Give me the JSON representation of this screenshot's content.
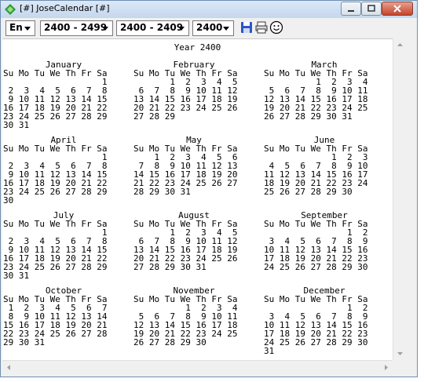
{
  "window": {
    "title": "[#] JoseCalendar [#]"
  },
  "toolbar": {
    "language": "En",
    "century": "2400 - 2499",
    "decade": "2400 - 2409",
    "year": "2400",
    "icons": [
      "save-icon",
      "print-icon",
      "smiley-icon"
    ]
  },
  "calendar": {
    "year_title": "Year 2400",
    "weekday_header": "Su Mo Tu We Th Fr Sa",
    "months": [
      {
        "name": "January",
        "weeks": [
          "                   1",
          " 2  3  4  5  6  7  8",
          " 9 10 11 12 13 14 15",
          "16 17 18 19 20 21 22",
          "23 24 25 26 27 28 29",
          "30 31"
        ]
      },
      {
        "name": "February",
        "weeks": [
          "       1  2  3  4  5",
          " 6  7  8  9 10 11 12",
          "13 14 15 16 17 18 19",
          "20 21 22 23 24 25 26",
          "27 28 29"
        ]
      },
      {
        "name": "March",
        "weeks": [
          "          1  2  3  4",
          " 5  6  7  8  9 10 11",
          "12 13 14 15 16 17 18",
          "19 20 21 22 23 24 25",
          "26 27 28 29 30 31"
        ]
      },
      {
        "name": "April",
        "weeks": [
          "                   1",
          " 2  3  4  5  6  7  8",
          " 9 10 11 12 13 14 15",
          "16 17 18 19 20 21 22",
          "23 24 25 26 27 28 29",
          "30"
        ]
      },
      {
        "name": "May",
        "weeks": [
          "    1  2  3  4  5  6",
          " 7  8  9 10 11 12 13",
          "14 15 16 17 18 19 20",
          "21 22 23 24 25 26 27",
          "28 29 30 31"
        ]
      },
      {
        "name": "June",
        "weeks": [
          "             1  2  3",
          " 4  5  6  7  8  9 10",
          "11 12 13 14 15 16 17",
          "18 19 20 21 22 23 24",
          "25 26 27 28 29 30"
        ]
      },
      {
        "name": "July",
        "weeks": [
          "                   1",
          " 2  3  4  5  6  7  8",
          " 9 10 11 12 13 14 15",
          "16 17 18 19 20 21 22",
          "23 24 25 26 27 28 29",
          "30 31"
        ]
      },
      {
        "name": "August",
        "weeks": [
          "       1  2  3  4  5",
          " 6  7  8  9 10 11 12",
          "13 14 15 16 17 18 19",
          "20 21 22 23 24 25 26",
          "27 28 29 30 31"
        ]
      },
      {
        "name": "September",
        "weeks": [
          "                1  2",
          " 3  4  5  6  7  8  9",
          "10 11 12 13 14 15 16",
          "17 18 19 20 21 22 23",
          "24 25 26 27 28 29 30"
        ]
      },
      {
        "name": "October",
        "weeks": [
          " 1  2  3  4  5  6  7",
          " 8  9 10 11 12 13 14",
          "15 16 17 18 19 20 21",
          "22 23 24 25 26 27 28",
          "29 30 31"
        ]
      },
      {
        "name": "November",
        "weeks": [
          "          1  2  3  4",
          " 5  6  7  8  9 10 11",
          "12 13 14 15 16 17 18",
          "19 20 21 22 23 24 25",
          "26 27 28 29 30"
        ]
      },
      {
        "name": "December",
        "weeks": [
          "                1  2",
          " 3  4  5  6  7  8  9",
          "10 11 12 13 14 15 16",
          "17 18 19 20 21 22 23",
          "24 25 26 27 28 29 30",
          "31"
        ]
      }
    ]
  }
}
